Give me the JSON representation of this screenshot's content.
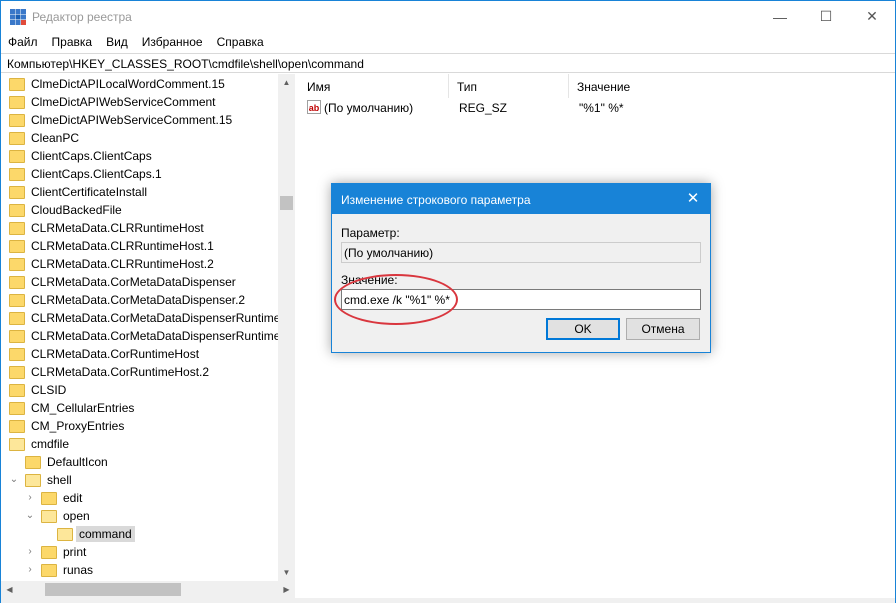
{
  "window": {
    "title": "Редактор реестра",
    "minimize": "—",
    "maximize": "☐",
    "close": "✕"
  },
  "menu": [
    "Файл",
    "Правка",
    "Вид",
    "Избранное",
    "Справка"
  ],
  "address": "Компьютер\\HKEY_CLASSES_ROOT\\cmdfile\\shell\\open\\command",
  "tree": {
    "top_items": [
      "ClmeDictAPILocalWordComment.15",
      "ClmeDictAPIWebServiceComment",
      "ClmeDictAPIWebServiceComment.15",
      "CleanPC",
      "ClientCaps.ClientCaps",
      "ClientCaps.ClientCaps.1",
      "ClientCertificateInstall",
      "CloudBackedFile",
      "CLRMetaData.CLRRuntimeHost",
      "CLRMetaData.CLRRuntimeHost.1",
      "CLRMetaData.CLRRuntimeHost.2",
      "CLRMetaData.CorMetaDataDispenser",
      "CLRMetaData.CorMetaDataDispenser.2",
      "CLRMetaData.CorMetaDataDispenserRuntime",
      "CLRMetaData.CorMetaDataDispenserRuntime.2",
      "CLRMetaData.CorRuntimeHost",
      "CLRMetaData.CorRuntimeHost.2",
      "CLSID",
      "CM_CellularEntries",
      "CM_ProxyEntries",
      "cmdfile"
    ],
    "cmdfile_children": {
      "default_icon": "DefaultIcon",
      "shell": "shell",
      "edit": "edit",
      "open": "open",
      "command": "command",
      "print": "print",
      "runas": "runas"
    }
  },
  "list": {
    "headers": [
      "Имя",
      "Тип",
      "Значение"
    ],
    "rows": [
      {
        "name": "(По умолчанию)",
        "type": "REG_SZ",
        "value": "\"%1\" %*"
      }
    ]
  },
  "dialog": {
    "title": "Изменение строкового параметра",
    "param_label": "Параметр:",
    "param_value": "(По умолчанию)",
    "value_label": "Значение:",
    "value_text": "cmd.exe /k \"%1\" %*",
    "ok": "OK",
    "cancel": "Отмена",
    "close": "✕"
  },
  "colors": {
    "accent": "#1883d7",
    "folder": "#fcd86a",
    "highlight": "#d9363e"
  }
}
